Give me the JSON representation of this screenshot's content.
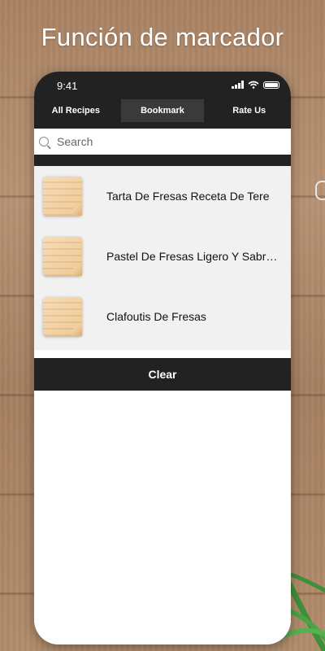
{
  "headline": "Función de marcador",
  "status": {
    "time": "9:41"
  },
  "tabs": [
    {
      "label": "All Recipes",
      "active": false
    },
    {
      "label": "Bookmark",
      "active": true
    },
    {
      "label": "Rate Us",
      "active": false
    }
  ],
  "search": {
    "placeholder": "Search",
    "value": ""
  },
  "bookmarks": [
    {
      "title": "Tarta De Fresas Receta De Tere",
      "icon": "note-paper-icon"
    },
    {
      "title": "Pastel De Fresas Ligero Y Sabro...",
      "icon": "note-paper-icon"
    },
    {
      "title": "Clafoutis De Fresas",
      "icon": "note-paper-icon"
    }
  ],
  "clear_button": {
    "label": "Clear"
  },
  "colors": {
    "bar": "#222222",
    "list_bg": "#f1f1f1",
    "wood": "#a98262"
  }
}
